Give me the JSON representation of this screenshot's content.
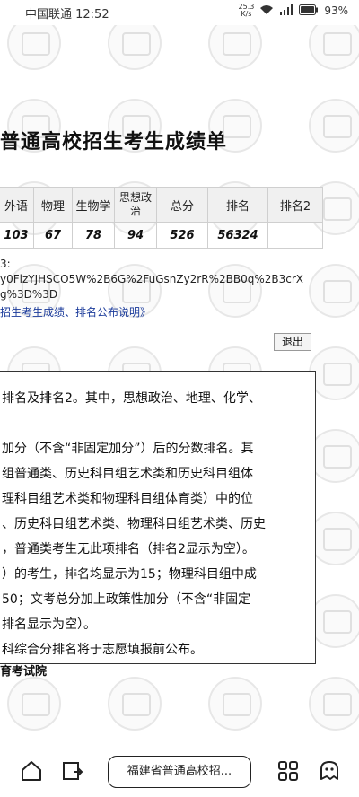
{
  "status_bar": {
    "carrier_time": "中国联通 12:52",
    "net_speed_top": "25.3",
    "net_speed_bottom": "K/s",
    "battery": "93%"
  },
  "page": {
    "title": "普通高校招生考生成绩单",
    "table": {
      "headers": [
        "外语",
        "物理",
        "生物学",
        "思想政治",
        "总分",
        "排名",
        "排名2"
      ],
      "values": [
        "103",
        "67",
        "78",
        "94",
        "526",
        "56324",
        ""
      ]
    },
    "note_line1": "3:",
    "note_line2": "y0FlzYJHSCO5W%2B6G%2FuGsnZy2rR%2BB0q%2B3crX",
    "note_line3": "g%3D%3D",
    "link_text": "招生考生成绩、排名公布说明》",
    "logout_label": "退出",
    "notice_lines": [
      "排名及排名2。其中，思想政治、地理、化学、",
      "",
      "加分（不含“非固定加分”）后的分数排名。其",
      "组普通类、历史科目组艺术类和历史科目组体",
      "理科目组艺术类和物理科目组体育类）中的位",
      "、历史科目组艺术类、物理科目组艺术类、历史",
      "，普通类考生无此项排名（排名2显示为空）。",
      "）的考生，排名均显示为15；物理科目组中成",
      "50；文考总分加上政策性加分（不含“非固定",
      "排名显示为空）。",
      "科综合分排名将于志愿填报前公布。"
    ],
    "signature": "育考试院"
  },
  "bottom_nav": {
    "tab_title": "福建省普通高校招..."
  }
}
